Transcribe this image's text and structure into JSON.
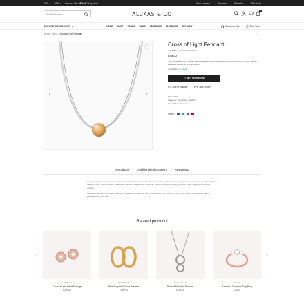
{
  "topbar": {
    "currency": "ENG ⌄",
    "lang": "USD ⌄",
    "promo_prefix": "Summer Sale",
    "promo_bold": "15% off",
    "promo_suffix": "Shop Now!",
    "links": [
      "Store Location",
      "Services",
      "Subscribe",
      "Gift Cards"
    ]
  },
  "header": {
    "search_placeholder": "Search Products",
    "logo": "ALUKAS & CO",
    "cart_count": "0"
  },
  "nav": {
    "browse": "BROWSE CATEGORIES ⌄",
    "menu": [
      "HOME",
      "SHOP",
      "PAGES",
      "BLOG",
      "FEATURES",
      "ELEMENTS",
      "BUY NOW"
    ],
    "customer_care": "Customer Care",
    "find_store": "Find Store"
  },
  "breadcrumb": [
    "Home",
    "Shop",
    "Cross of Light Pendant"
  ],
  "product": {
    "title": "Cross of Light Pendant",
    "stars": "★★★★☆",
    "reviews": "(1 Customer Review)",
    "price": "£75.00",
    "description": "This signature hoy a halltail llaightiegel and high flow rate with reduced pressure drop it has an excellent degree of condensation.",
    "availability_label": "Availability:",
    "availability_value": "In Stock",
    "buy_label": "BUY ON AMAZON",
    "wishlist": "Add to Wishlist",
    "size_guide": "Size Guide",
    "sku": "SKU: 1003",
    "categories": "Category: Necklaces, Modern",
    "tags": "Tags: Silver, Women",
    "share_label": "Share:"
  },
  "tabs": [
    "Description",
    "Additional Information",
    "Reviews(2)"
  ],
  "description_body": [
    "Cookie dragee croissant dessert. Powder marshmallow pie wafer dessert sesame soft candies tart cupcake. I set cat cake lollipop lollipop halvah chupa chups bonbon sugar plum dessert. Carrot cake marzipan cupcake caramels candy powder wafer sugar plum powder powder.",
    "Macaroon topping chocolate. Cake jelly beans icing tiramisu. Ice cream bonbon tart sesame snaps bear claw chocolate bar candy pudding halls caramels."
  ],
  "related": {
    "title": "Related products",
    "items": [
      {
        "category": "EARRINGS",
        "name": "Circle of Light Heart Earrings",
        "price": "£299.00"
      },
      {
        "category": "EARRINGS",
        "name": "Blue Shapes & Stone Bracelet",
        "price": "£199.00"
      },
      {
        "category": "NECKLACES",
        "name": "Birds of Paradise Pendant",
        "price": "£799.00"
      },
      {
        "category": "RINGS",
        "name": "Kalmesia Diamond Ring Ring",
        "price": "£39.00"
      }
    ]
  },
  "colors": {
    "topbar": "#1f1f1f",
    "in_stock": "#2ea44f",
    "gold": "#e0a560"
  }
}
